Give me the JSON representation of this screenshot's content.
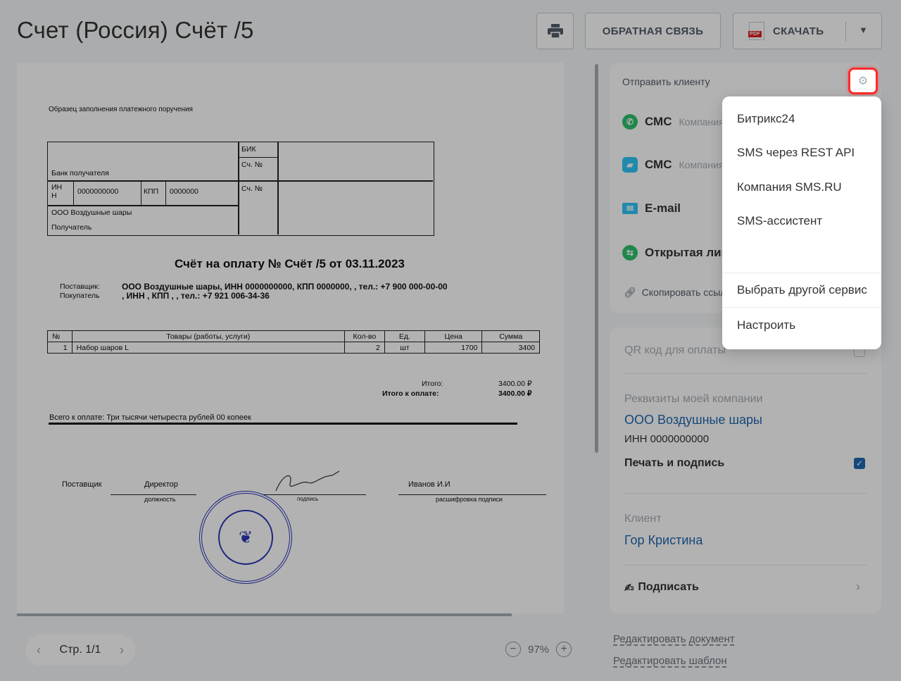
{
  "header": {
    "title": "Счет (Россия) Счёт /5",
    "print_icon": "printer-icon",
    "feedback_label": "ОБРАТНАЯ СВЯЗЬ",
    "download_label": "СКАЧАТЬ",
    "pdf_badge": "PDF"
  },
  "document": {
    "sample_caption": "Образец заполнения платежного поручения",
    "bank_label": "Банк получателя",
    "bik_label": "БИК",
    "account_label_1": "Сч. №",
    "account_label_2": "Сч. №",
    "inn_label": "ИН Н",
    "inn_value": "0000000000",
    "kpp_label": "КПП",
    "kpp_value": "0000000",
    "recipient_name": "ООО Воздушные шары",
    "recipient_label": "Получатель",
    "title": "Счёт на оплату № Счёт /5 от 03.11.2023",
    "supplier_label": "Поставщик:",
    "supplier_value": "ООО Воздушные шары, ИНН 0000000000, КПП 0000000, , тел.: +7 900 000-00-00",
    "buyer_label": "Покупатель",
    "buyer_value": ", ИНН , КПП , , тел.: +7 921 006-34-36",
    "table_headers": [
      "№",
      "Товары (работы, услуги)",
      "Кол-во",
      "Ед.",
      "Цена",
      "Сумма"
    ],
    "table_row": [
      "1",
      "Набор шаров L",
      "2",
      "шт",
      "1700",
      "3400"
    ],
    "total_label": "Итого:",
    "total_value": "3400.00 ₽",
    "total_due_label": "Итого к оплате:",
    "total_due_value": "3400.00 ₽",
    "sum_words": "Всего к оплате: Три тысячи четыреста рублей 00 копеек",
    "sign_supplier": "Поставщик",
    "sign_position": "Директор",
    "sign_position_caption": "должность",
    "sign_caption": "подпись",
    "sign_name": "Иванов И.И",
    "sign_name_caption": "расшифровка подписи"
  },
  "pager": {
    "label": "Стр. 1/1"
  },
  "zoom": {
    "value": "97%"
  },
  "send_panel": {
    "title": "Отправить клиенту",
    "channels": [
      {
        "label": "СМС",
        "sub": "Компания",
        "icon": "whatsapp-icon",
        "color": "#2fc26e"
      },
      {
        "label": "СМС",
        "sub": "Компания",
        "icon": "chat-icon",
        "color": "#2fc6f6"
      },
      {
        "label": "E-mail",
        "sub": "",
        "icon": "mail-icon",
        "color": "#2fc6f6"
      },
      {
        "label": "Открытая линия",
        "sub": "",
        "icon": "openline-icon",
        "color": "#2fc26e"
      }
    ],
    "copy_link": "Скопировать ссылку"
  },
  "info_panel": {
    "qr_label": "QR код для оплаты",
    "company_label": "Реквизиты моей компании",
    "company_name": "ООО Воздушные шары",
    "company_inn": "ИНН 0000000000",
    "print_sign_label": "Печать и подпись",
    "client_label": "Клиент",
    "client_name": "Гор Кристина",
    "sign_label": "Подписать"
  },
  "footer_links": {
    "edit_document": "Редактировать документ",
    "edit_template": "Редактировать шаблон"
  },
  "dropdown": {
    "items": [
      "Битрикс24",
      "SMS через REST API",
      "Компания SMS.RU",
      "SMS-ассистент"
    ],
    "other_service": "Выбрать другой сервис",
    "configure": "Настроить"
  }
}
